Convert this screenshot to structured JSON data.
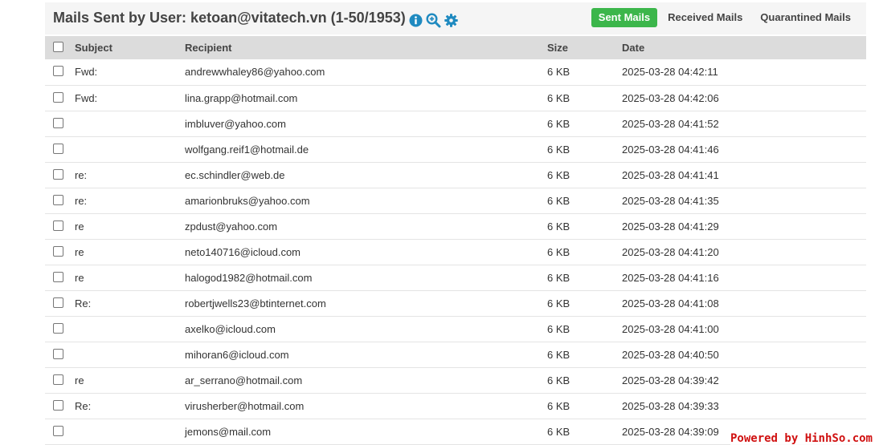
{
  "header": {
    "title": "Mails Sent by User: ketoan@vitatech.vn (1-50/1953)",
    "icons": [
      "info-icon",
      "zoom-in-icon",
      "gear-icon"
    ],
    "tabs": [
      {
        "label": "Sent Mails",
        "active": true
      },
      {
        "label": "Received Mails",
        "active": false
      },
      {
        "label": "Quarantined Mails",
        "active": false
      }
    ]
  },
  "colors": {
    "accent": "#3cb64b",
    "icon": "#1f8ac0",
    "watermark": "#d01010"
  },
  "table": {
    "columns": {
      "subject": "Subject",
      "recipient": "Recipient",
      "size": "Size",
      "date": "Date"
    },
    "rows": [
      {
        "subject": "Fwd:",
        "recipient": "andrewwhaley86@yahoo.com",
        "size": "6 KB",
        "date": "2025-03-28 04:42:11"
      },
      {
        "subject": "Fwd:",
        "recipient": "lina.grapp@hotmail.com",
        "size": "6 KB",
        "date": "2025-03-28 04:42:06"
      },
      {
        "subject": "",
        "recipient": "imbluver@yahoo.com",
        "size": "6 KB",
        "date": "2025-03-28 04:41:52"
      },
      {
        "subject": "",
        "recipient": "wolfgang.reif1@hotmail.de",
        "size": "6 KB",
        "date": "2025-03-28 04:41:46"
      },
      {
        "subject": "re:",
        "recipient": "ec.schindler@web.de",
        "size": "6 KB",
        "date": "2025-03-28 04:41:41"
      },
      {
        "subject": "re:",
        "recipient": "amarionbruks@yahoo.com",
        "size": "6 KB",
        "date": "2025-03-28 04:41:35"
      },
      {
        "subject": "re",
        "recipient": "zpdust@yahoo.com",
        "size": "6 KB",
        "date": "2025-03-28 04:41:29"
      },
      {
        "subject": "re",
        "recipient": "neto140716@icloud.com",
        "size": "6 KB",
        "date": "2025-03-28 04:41:20"
      },
      {
        "subject": "re",
        "recipient": "halogod1982@hotmail.com",
        "size": "6 KB",
        "date": "2025-03-28 04:41:16"
      },
      {
        "subject": "Re:",
        "recipient": "robertjwells23@btinternet.com",
        "size": "6 KB",
        "date": "2025-03-28 04:41:08"
      },
      {
        "subject": "",
        "recipient": "axelko@icloud.com",
        "size": "6 KB",
        "date": "2025-03-28 04:41:00"
      },
      {
        "subject": "",
        "recipient": "mihoran6@icloud.com",
        "size": "6 KB",
        "date": "2025-03-28 04:40:50"
      },
      {
        "subject": "re",
        "recipient": "ar_serrano@hotmail.com",
        "size": "6 KB",
        "date": "2025-03-28 04:39:42"
      },
      {
        "subject": "Re:",
        "recipient": "virusherber@hotmail.com",
        "size": "6 KB",
        "date": "2025-03-28 04:39:33"
      },
      {
        "subject": "",
        "recipient": "jemons@mail.com",
        "size": "6 KB",
        "date": "2025-03-28 04:39:09"
      }
    ]
  },
  "watermark": "Powered by HinhSo.com"
}
